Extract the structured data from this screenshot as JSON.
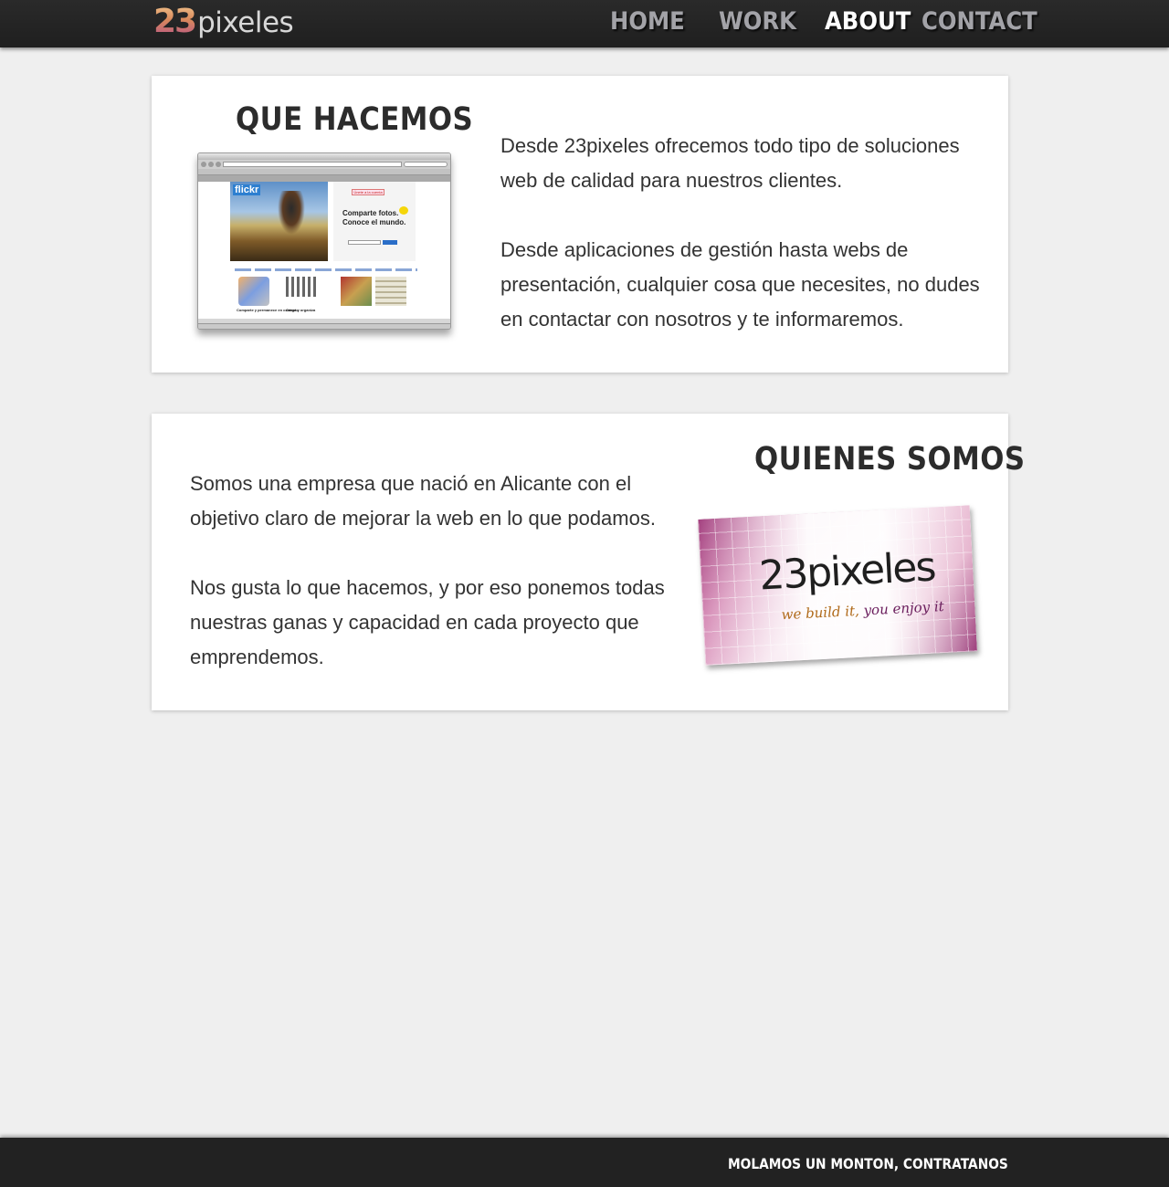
{
  "header": {
    "logo": {
      "number": "23",
      "word": "pixeles"
    },
    "nav": [
      {
        "label": "HOME",
        "active": false
      },
      {
        "label": "WORK",
        "active": false
      },
      {
        "label": "ABOUT",
        "active": true
      },
      {
        "label": "CONTACT",
        "active": false
      }
    ]
  },
  "sections": {
    "que_hacemos": {
      "title": "QUE HACEMOS",
      "paragraphs": [
        "Desde 23pixeles ofrecemos todo tipo de soluciones web de calidad para nuestros clientes.",
        "Desde aplicaciones de gestión hasta webs de presentación, cualquier cosa que necesites, no dudes en contactar con nosotros y te informaremos."
      ],
      "screenshot": {
        "site_logo": "flickr",
        "join_button": "Únete a la cuenta",
        "tagline": "Comparte fotos. Conoce el mundo.",
        "captions": [
          "Comparte y permanece en contacto",
          "Carga y organiza"
        ]
      }
    },
    "quienes_somos": {
      "title": "QUIENES SOMOS",
      "paragraphs": [
        "Somos una empresa que nació en Alicante con el objetivo claro de mejorar la web en lo que podamos.",
        "Nos gusta lo que hacemos, y por eso ponemos todas nuestras ganas y capacidad en cada proyecto que emprendemos."
      ],
      "card": {
        "name": "23pixeles",
        "tagline_a": "we build it,",
        "tagline_b": "you enjoy it"
      }
    }
  },
  "footer": {
    "text": "MOLAMOS UN MONTON, CONTRATANOS"
  },
  "colors": {
    "header_bg": "#222222",
    "page_bg": "#efefef",
    "nav_inactive": "#a3a3a8",
    "nav_active": "#ffffff",
    "heading": "#2c2c2c",
    "body_text": "#333333"
  }
}
